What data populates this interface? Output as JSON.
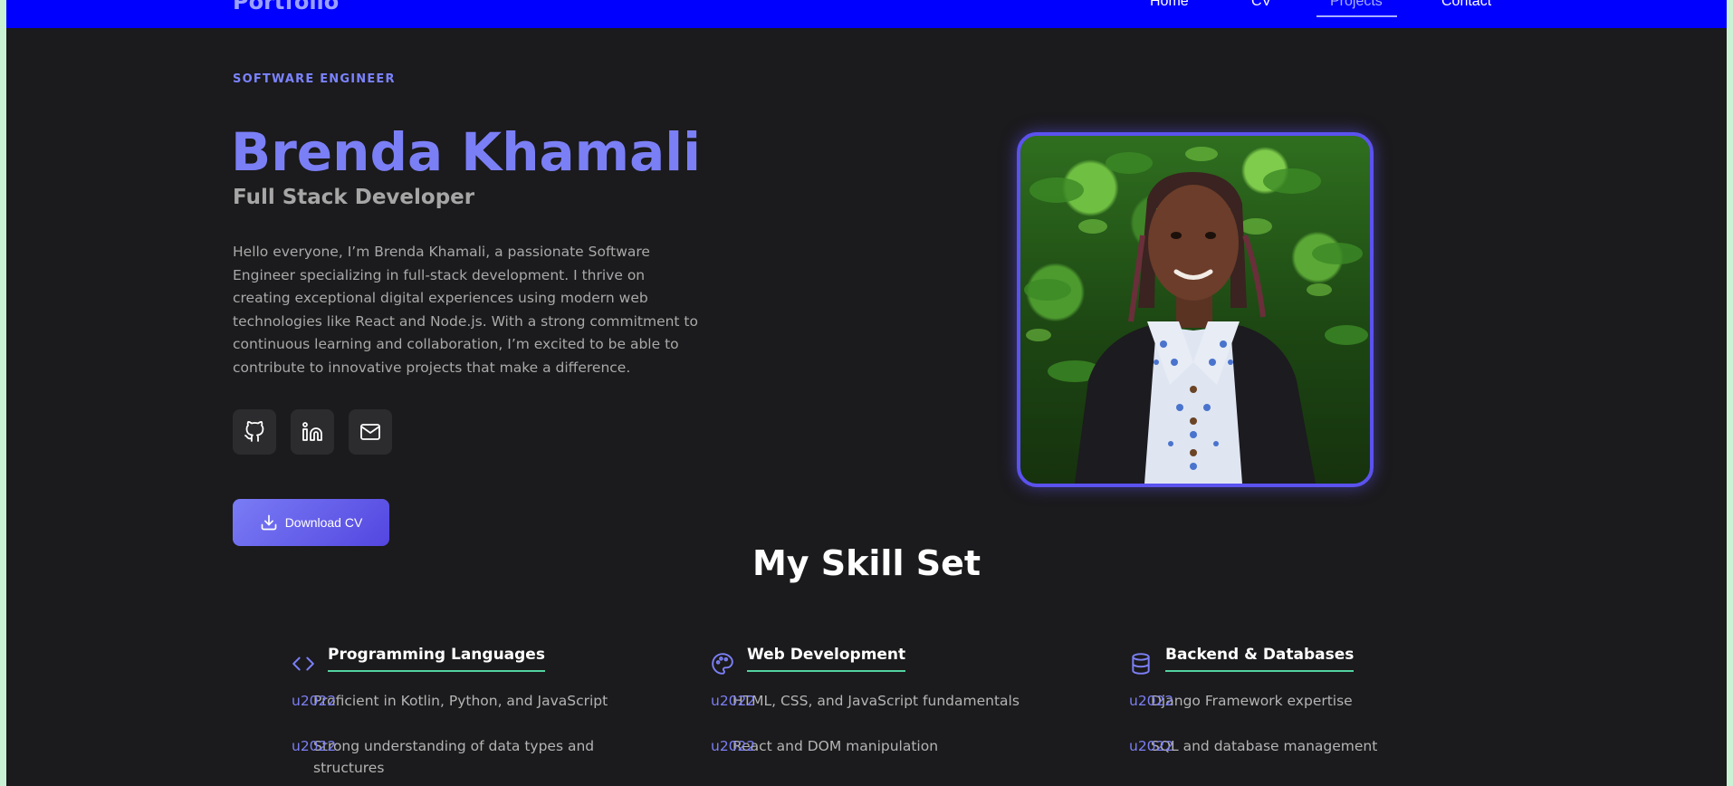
{
  "nav": {
    "brand": "Portfolio",
    "links": [
      {
        "label": "Home"
      },
      {
        "label": "CV"
      },
      {
        "label": "Projects"
      },
      {
        "label": "Contact"
      }
    ]
  },
  "hero": {
    "eyebrow": "SOFTWARE ENGINEER",
    "name": "Brenda Khamali",
    "role": "Full Stack Developer",
    "bio": "Hello everyone, I’m Brenda Khamali, a passionate Software Engineer specializing in full-stack development. I thrive on creating exceptional digital experiences using modern web technologies like React and Node.js. With a strong commitment to continuous learning and collaboration, I’m excited to be able to contribute to innovative projects that make a difference.",
    "socials": [
      {
        "icon": "github-icon"
      },
      {
        "icon": "linkedin-icon"
      },
      {
        "icon": "mail-icon"
      }
    ],
    "download_cv_label": "Download CV"
  },
  "skills": {
    "title": "My Skill Set",
    "columns": [
      {
        "icon": "code-icon",
        "title": "Programming Languages",
        "items": [
          {
            "bullet": "u2022",
            "text": "Proficient in Kotlin, Python, and JavaScript"
          },
          {
            "bullet": "u2022",
            "text": "Strong understanding of data types and structures"
          }
        ]
      },
      {
        "icon": "palette-icon",
        "title": "Web Development",
        "items": [
          {
            "bullet": "u2022",
            "text": "HTML, CSS, and JavaScript fundamentals"
          },
          {
            "bullet": "u2022",
            "text": "React and DOM manipulation"
          }
        ]
      },
      {
        "icon": "database-icon",
        "title": "Backend & Databases",
        "items": [
          {
            "bullet": "u2022",
            "text": "Django Framework expertise"
          },
          {
            "bullet": "u2022",
            "text": "SQL and database management"
          }
        ]
      }
    ]
  },
  "colors": {
    "nav_bg": "#0000ff",
    "page_bg": "#1b1a1c",
    "accent": "#7b7ff5",
    "underline": "#53d3a0"
  }
}
